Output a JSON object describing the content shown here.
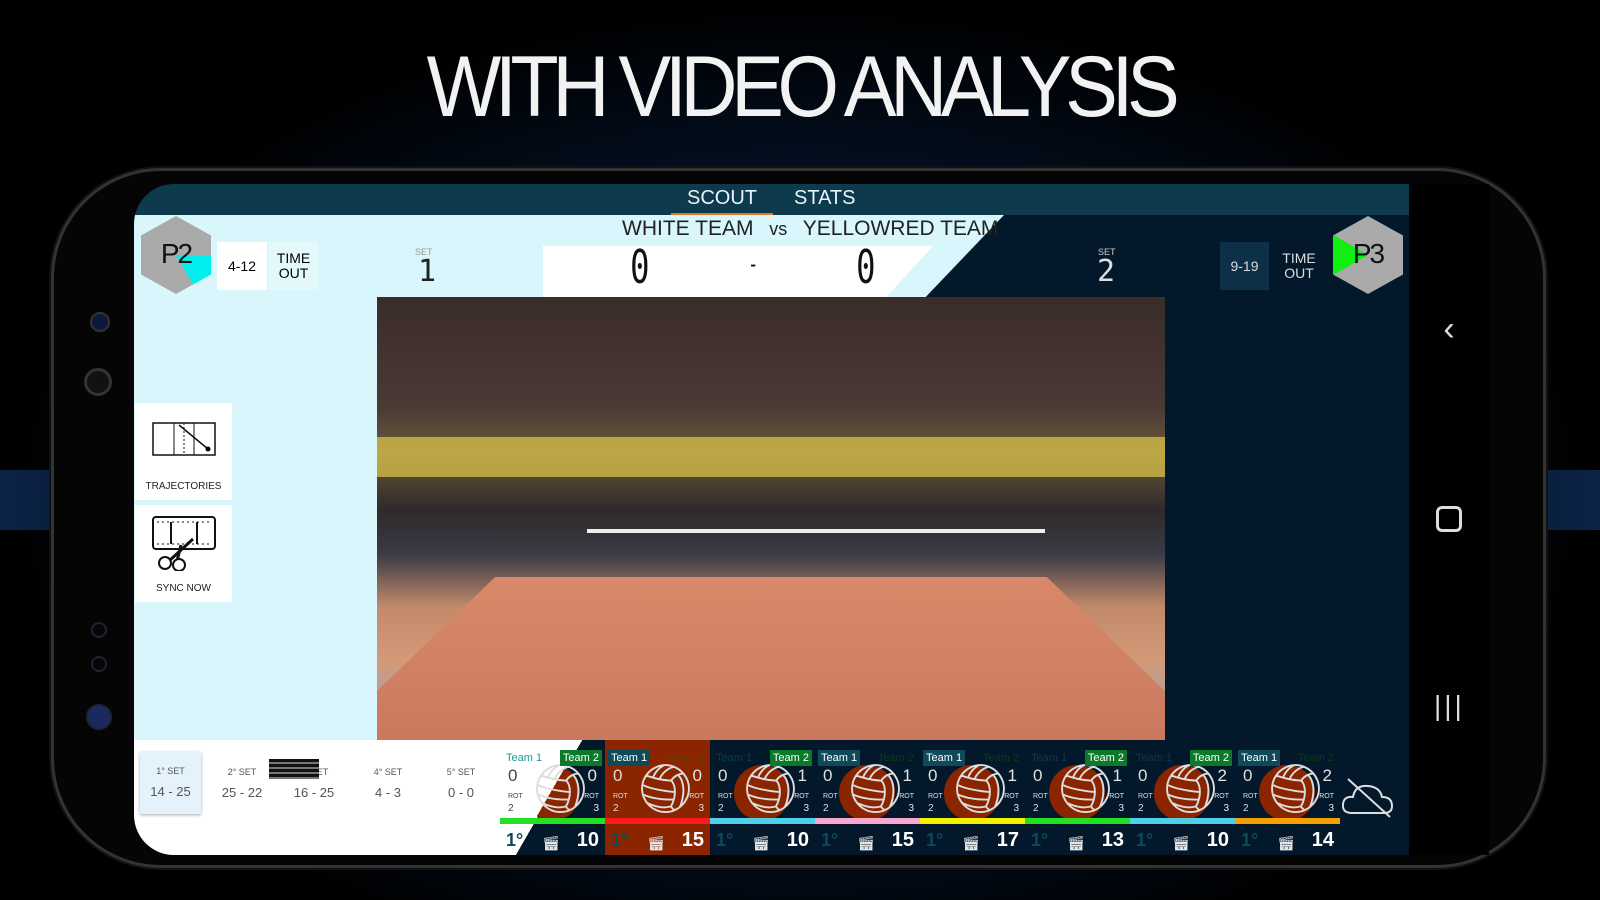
{
  "headline": "WITH VIDEO ANALYSIS",
  "tabs": [
    {
      "label": "SCOUT",
      "active": true
    },
    {
      "label": "STATS",
      "active": false
    }
  ],
  "match": {
    "home": "WHITE TEAM",
    "vs": "vs",
    "away": "YELLOWRED TEAM",
    "home_score": "0",
    "separator": "-",
    "away_score": "0"
  },
  "left_team": {
    "position": "P2",
    "partial": "4-12",
    "timeout": "TIME OUT",
    "set_label": "SET",
    "set": "1"
  },
  "right_team": {
    "position": "P3",
    "partial": "9-19",
    "timeout": "TIME OUT",
    "set_label": "SET",
    "set": "2"
  },
  "tools": [
    {
      "label": "TRAJECTORIES",
      "icon": "trajectories-icon"
    },
    {
      "label": "SYNC NOW",
      "icon": "scissors-film-icon"
    }
  ],
  "sets": [
    {
      "label": "1° SET",
      "score": "14 - 25"
    },
    {
      "label": "2° SET",
      "score": "25 - 22"
    },
    {
      "label": "3° SET",
      "score": "16 - 25"
    },
    {
      "label": "4° SET",
      "score": "4 - 3"
    },
    {
      "label": "5° SET",
      "score": "0 - 0"
    }
  ],
  "rally_cards": [
    {
      "team1": "Team 1",
      "team2": "Team 2",
      "active": "team2",
      "score1": "0",
      "score2": "0",
      "rot1": "2",
      "rot2": "3",
      "bar_color": "#22e022",
      "set": "1°",
      "points": "10",
      "style": "split"
    },
    {
      "team1": "Team 1",
      "team2": "Team 2",
      "active": "team1",
      "score1": "0",
      "score2": "0",
      "rot1": "2",
      "rot2": "3",
      "bar_color": "#ff1a1a",
      "set": "1°",
      "points": "15",
      "style": "red"
    },
    {
      "team1": "Team 1",
      "team2": "Team 2",
      "active": "team2",
      "score1": "0",
      "score2": "1",
      "rot1": "2",
      "rot2": "3",
      "bar_color": "#4fd0e8",
      "set": "1°",
      "points": "10",
      "style": "dark"
    },
    {
      "team1": "Team 1",
      "team2": "Team 2",
      "active": "team1",
      "score1": "0",
      "score2": "1",
      "rot1": "2",
      "rot2": "3",
      "bar_color": "#f7a8d0",
      "set": "1°",
      "points": "15",
      "style": "dark"
    },
    {
      "team1": "Team 1",
      "team2": "Team 2",
      "active": "team1",
      "score1": "0",
      "score2": "1",
      "rot1": "2",
      "rot2": "3",
      "bar_color": "#f5f000",
      "set": "1°",
      "points": "17",
      "style": "dark"
    },
    {
      "team1": "Team 1",
      "team2": "Team 2",
      "active": "team2",
      "score1": "0",
      "score2": "1",
      "rot1": "2",
      "rot2": "3",
      "bar_color": "#22e022",
      "set": "1°",
      "points": "13",
      "style": "dark"
    },
    {
      "team1": "Team 1",
      "team2": "Team 2",
      "active": "team2",
      "score1": "0",
      "score2": "2",
      "rot1": "2",
      "rot2": "3",
      "bar_color": "#4fd0e8",
      "set": "1°",
      "points": "10",
      "style": "dark"
    },
    {
      "team1": "Team 1",
      "team2": "Team 2",
      "active": "team1",
      "score1": "0",
      "score2": "2",
      "rot1": "2",
      "rot2": "3",
      "bar_color": "#f5a000",
      "set": "1°",
      "points": "14",
      "style": "dark"
    }
  ],
  "rot_label": "ROT",
  "sync_status_icon": "cloud-off-icon",
  "colors": {
    "accent": "#e8781e",
    "topbar": "#0e3a4e",
    "panel": "#d8f6fb",
    "dark": "#03192b",
    "team1_tag": "#0e4a5a",
    "team2_tag": "#0a7a2a"
  }
}
